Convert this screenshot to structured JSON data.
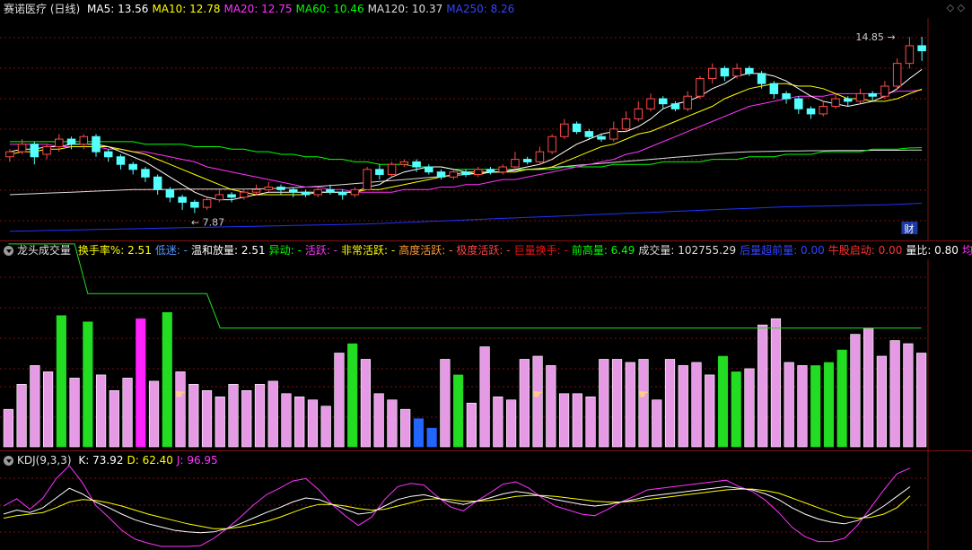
{
  "colors": {
    "bg": "#000000",
    "up": "#ff4a4a",
    "down": "#54ffff",
    "grid": "#7a1010",
    "ma5": "#ffffff",
    "ma10": "#ffff00",
    "ma20": "#ff33ff",
    "ma60": "#00ff00",
    "ma120": "#dddddd",
    "ma250": "#2233ff"
  },
  "price_panel": {
    "title": "赛诺医疗 (日线)",
    "indicators": [
      {
        "label": "MA5: 13.56",
        "color": "#ffffff"
      },
      {
        "label": "MA10: 12.78",
        "color": "#ffff00"
      },
      {
        "label": "MA20: 12.75",
        "color": "#ff33ff"
      },
      {
        "label": "MA60: 10.46",
        "color": "#00ff00"
      },
      {
        "label": "MA120: 10.37",
        "color": "#dddddd"
      },
      {
        "label": "MA250: 8.26",
        "color": "#3344ff"
      }
    ],
    "high_label": "14.85",
    "low_label": "7.87",
    "cai_badge": "财",
    "corner_icons": "◇  ◇"
  },
  "volume_panel": {
    "title": "龙头成交量",
    "indicators": [
      {
        "label": "换手率%: 2.51",
        "color": "#ffff00"
      },
      {
        "label": "低迷: -",
        "color": "#5599ff"
      },
      {
        "label": "温和放量: 2.51",
        "color": "#ffffff"
      },
      {
        "label": "异动: -",
        "color": "#00ff00"
      },
      {
        "label": "活跃: -",
        "color": "#ff33ff"
      },
      {
        "label": "非常活跃: -",
        "color": "#ffff00"
      },
      {
        "label": "高度活跃: -",
        "color": "#ff9933"
      },
      {
        "label": "极度活跃: -",
        "color": "#ff4444"
      },
      {
        "label": "巨量换手: -",
        "color": "#ee1111"
      },
      {
        "label": "前高量: 6.49",
        "color": "#00ff00"
      },
      {
        "label": "成交量: 102755.29",
        "color": "#dddddd"
      },
      {
        "label": "后量超前量: 0.00",
        "color": "#3344ff"
      },
      {
        "label": "牛股启动: 0.00",
        "color": "#ff3333"
      },
      {
        "label": "量比: 0.80",
        "color": "#ffffff"
      },
      {
        "label": "均量金叉",
        "color": "#ff33ff"
      }
    ]
  },
  "kdj_panel": {
    "title": "KDJ(9,3,3)",
    "indicators": [
      {
        "label": "K: 73.92",
        "color": "#ffffff"
      },
      {
        "label": "D: 62.40",
        "color": "#ffff00"
      },
      {
        "label": "J: 96.95",
        "color": "#ff33ff"
      }
    ]
  },
  "chart_data": {
    "type": "candlestick",
    "price_range": [
      7.0,
      15.6
    ],
    "candles": [
      [
        10.1,
        10.3,
        9.9,
        10.4
      ],
      [
        10.3,
        10.6,
        10.2,
        10.8
      ],
      [
        10.6,
        10.1,
        9.8,
        10.7
      ],
      [
        10.2,
        10.5,
        10.0,
        10.6
      ],
      [
        10.5,
        10.8,
        10.3,
        11.0
      ],
      [
        10.8,
        10.6,
        10.4,
        10.9
      ],
      [
        10.6,
        10.9,
        10.4,
        11.0
      ],
      [
        10.9,
        10.3,
        10.1,
        11.0
      ],
      [
        10.3,
        10.1,
        9.9,
        10.4
      ],
      [
        10.1,
        9.8,
        9.6,
        10.2
      ],
      [
        9.8,
        9.6,
        9.4,
        9.9
      ],
      [
        9.6,
        9.3,
        9.1,
        9.7
      ],
      [
        9.3,
        8.8,
        8.6,
        9.4
      ],
      [
        8.8,
        8.5,
        8.3,
        8.9
      ],
      [
        8.5,
        8.3,
        8.0,
        8.6
      ],
      [
        8.3,
        8.1,
        7.87,
        8.4
      ],
      [
        8.1,
        8.4,
        8.0,
        8.5
      ],
      [
        8.4,
        8.6,
        8.3,
        8.8
      ],
      [
        8.6,
        8.5,
        8.3,
        8.7
      ],
      [
        8.5,
        8.7,
        8.4,
        8.8
      ],
      [
        8.7,
        8.8,
        8.6,
        9.0
      ],
      [
        8.8,
        8.9,
        8.7,
        9.1
      ],
      [
        8.9,
        8.8,
        8.6,
        9.0
      ],
      [
        8.8,
        8.7,
        8.5,
        8.9
      ],
      [
        8.7,
        8.6,
        8.5,
        8.8
      ],
      [
        8.6,
        8.8,
        8.5,
        8.9
      ],
      [
        8.8,
        8.7,
        8.6,
        9.0
      ],
      [
        8.7,
        8.6,
        8.4,
        8.8
      ],
      [
        8.6,
        8.8,
        8.5,
        8.9
      ],
      [
        8.8,
        9.6,
        8.8,
        9.7
      ],
      [
        9.6,
        9.4,
        9.2,
        9.8
      ],
      [
        9.4,
        9.8,
        9.3,
        9.9
      ],
      [
        9.8,
        9.9,
        9.7,
        10.0
      ],
      [
        9.9,
        9.7,
        9.5,
        10.0
      ],
      [
        9.7,
        9.5,
        9.4,
        9.8
      ],
      [
        9.5,
        9.3,
        9.2,
        9.6
      ],
      [
        9.3,
        9.5,
        9.2,
        9.6
      ],
      [
        9.5,
        9.4,
        9.3,
        9.6
      ],
      [
        9.4,
        9.6,
        9.3,
        9.7
      ],
      [
        9.6,
        9.5,
        9.4,
        9.7
      ],
      [
        9.5,
        9.7,
        9.4,
        9.8
      ],
      [
        9.7,
        10.0,
        9.6,
        10.3
      ],
      [
        10.0,
        9.9,
        9.8,
        10.1
      ],
      [
        9.9,
        10.3,
        9.8,
        10.5
      ],
      [
        10.3,
        10.9,
        10.2,
        11.0
      ],
      [
        10.9,
        11.4,
        10.8,
        11.6
      ],
      [
        11.4,
        11.1,
        11.0,
        11.5
      ],
      [
        11.1,
        10.9,
        10.8,
        11.2
      ],
      [
        10.9,
        10.8,
        10.7,
        11.0
      ],
      [
        10.8,
        11.2,
        10.7,
        11.5
      ],
      [
        11.2,
        11.6,
        11.1,
        11.9
      ],
      [
        11.6,
        12.0,
        11.5,
        12.3
      ],
      [
        12.0,
        12.4,
        11.9,
        12.6
      ],
      [
        12.4,
        12.2,
        12.0,
        12.5
      ],
      [
        12.2,
        12.0,
        11.9,
        12.3
      ],
      [
        12.0,
        12.5,
        11.9,
        12.7
      ],
      [
        12.5,
        13.2,
        12.4,
        13.3
      ],
      [
        13.2,
        13.6,
        13.0,
        13.8
      ],
      [
        13.6,
        13.3,
        13.1,
        13.7
      ],
      [
        13.3,
        13.6,
        13.2,
        13.8
      ],
      [
        13.6,
        13.4,
        13.3,
        13.7
      ],
      [
        13.4,
        13.0,
        12.8,
        13.5
      ],
      [
        13.0,
        12.6,
        12.4,
        13.1
      ],
      [
        12.6,
        12.4,
        12.2,
        12.7
      ],
      [
        12.4,
        12.0,
        11.8,
        12.5
      ],
      [
        12.0,
        11.8,
        11.6,
        12.1
      ],
      [
        11.8,
        12.1,
        11.7,
        12.3
      ],
      [
        12.1,
        12.4,
        12.0,
        12.6
      ],
      [
        12.4,
        12.3,
        12.1,
        12.5
      ],
      [
        12.3,
        12.6,
        12.2,
        12.8
      ],
      [
        12.6,
        12.5,
        12.3,
        12.7
      ],
      [
        12.5,
        12.9,
        12.4,
        13.1
      ],
      [
        12.9,
        13.8,
        12.8,
        14.0
      ],
      [
        13.8,
        14.5,
        13.6,
        14.85
      ],
      [
        14.5,
        14.3,
        13.9,
        14.85
      ]
    ],
    "ma5": [
      10.3,
      10.4,
      10.4,
      10.5,
      10.5,
      10.6,
      10.6,
      10.6,
      10.5,
      10.3,
      10.1,
      9.9,
      9.6,
      9.3,
      9.0,
      8.7,
      8.5,
      8.4,
      8.4,
      8.5,
      8.6,
      8.7,
      8.7,
      8.7,
      8.7,
      8.7,
      8.7,
      8.7,
      8.7,
      8.9,
      9.0,
      9.3,
      9.5,
      9.6,
      9.7,
      9.7,
      9.6,
      9.5,
      9.4,
      9.5,
      9.5,
      9.6,
      9.7,
      9.8,
      10.0,
      10.3,
      10.6,
      10.8,
      11.0,
      11.1,
      11.1,
      11.3,
      11.6,
      12.0,
      12.2,
      12.3,
      12.5,
      12.8,
      13.0,
      13.3,
      13.4,
      13.4,
      13.3,
      13.1,
      12.8,
      12.5,
      12.3,
      12.2,
      12.1,
      12.2,
      12.3,
      12.5,
      12.8,
      13.2,
      13.56
    ],
    "ma10": [
      10.2,
      10.3,
      10.3,
      10.4,
      10.4,
      10.5,
      10.5,
      10.5,
      10.5,
      10.4,
      10.3,
      10.2,
      10.0,
      9.8,
      9.6,
      9.4,
      9.2,
      9.0,
      8.8,
      8.7,
      8.6,
      8.6,
      8.6,
      8.6,
      8.6,
      8.7,
      8.7,
      8.7,
      8.7,
      8.8,
      8.8,
      8.9,
      9.0,
      9.1,
      9.2,
      9.3,
      9.4,
      9.5,
      9.5,
      9.5,
      9.5,
      9.5,
      9.6,
      9.6,
      9.7,
      9.9,
      10.1,
      10.3,
      10.5,
      10.6,
      10.8,
      11.0,
      11.1,
      11.3,
      11.5,
      11.7,
      11.9,
      12.1,
      12.4,
      12.6,
      12.8,
      12.9,
      13.0,
      13.0,
      12.9,
      12.9,
      12.8,
      12.6,
      12.4,
      12.4,
      12.3,
      12.3,
      12.4,
      12.6,
      12.78
    ],
    "ma20": [
      10.6,
      10.6,
      10.6,
      10.6,
      10.5,
      10.5,
      10.5,
      10.5,
      10.4,
      10.4,
      10.3,
      10.3,
      10.2,
      10.1,
      10.0,
      9.9,
      9.7,
      9.6,
      9.5,
      9.4,
      9.3,
      9.2,
      9.1,
      9.0,
      8.9,
      8.9,
      8.8,
      8.8,
      8.7,
      8.7,
      8.7,
      8.7,
      8.8,
      8.8,
      8.8,
      8.9,
      8.9,
      9.0,
      9.0,
      9.1,
      9.2,
      9.2,
      9.3,
      9.4,
      9.5,
      9.6,
      9.7,
      9.8,
      9.9,
      10.0,
      10.2,
      10.3,
      10.5,
      10.7,
      10.9,
      11.1,
      11.3,
      11.5,
      11.7,
      11.9,
      12.1,
      12.2,
      12.3,
      12.4,
      12.5,
      12.5,
      12.5,
      12.6,
      12.6,
      12.6,
      12.6,
      12.6,
      12.7,
      12.7,
      12.75
    ],
    "ma60": [
      10.7,
      10.7,
      10.7,
      10.7,
      10.7,
      10.7,
      10.7,
      10.7,
      10.7,
      10.7,
      10.7,
      10.6,
      10.6,
      10.6,
      10.6,
      10.5,
      10.5,
      10.5,
      10.4,
      10.4,
      10.3,
      10.3,
      10.2,
      10.2,
      10.1,
      10.1,
      10.0,
      10.0,
      9.9,
      9.9,
      9.8,
      9.8,
      9.8,
      9.7,
      9.7,
      9.7,
      9.6,
      9.6,
      9.6,
      9.6,
      9.6,
      9.6,
      9.6,
      9.6,
      9.6,
      9.7,
      9.7,
      9.7,
      9.7,
      9.8,
      9.8,
      9.8,
      9.8,
      9.9,
      9.9,
      9.9,
      9.9,
      10.0,
      10.0,
      10.0,
      10.1,
      10.1,
      10.1,
      10.2,
      10.2,
      10.2,
      10.3,
      10.3,
      10.3,
      10.3,
      10.4,
      10.4,
      10.4,
      10.45,
      10.46
    ],
    "ma120": [
      8.6,
      8.62,
      8.64,
      8.66,
      8.68,
      8.7,
      8.72,
      8.74,
      8.76,
      8.78,
      8.8,
      8.8,
      8.81,
      8.81,
      8.82,
      8.82,
      8.82,
      8.82,
      8.82,
      8.82,
      8.83,
      8.84,
      8.86,
      8.88,
      8.9,
      8.93,
      8.96,
      9.0,
      9.04,
      9.08,
      9.12,
      9.16,
      9.2,
      9.24,
      9.28,
      9.32,
      9.36,
      9.4,
      9.44,
      9.48,
      9.52,
      9.56,
      9.6,
      9.64,
      9.68,
      9.72,
      9.76,
      9.8,
      9.84,
      9.88,
      9.92,
      9.96,
      10.0,
      10.04,
      10.08,
      10.12,
      10.16,
      10.2,
      10.24,
      10.28,
      10.3,
      10.31,
      10.32,
      10.33,
      10.33,
      10.34,
      10.34,
      10.35,
      10.35,
      10.35,
      10.36,
      10.36,
      10.36,
      10.37,
      10.37
    ],
    "ma250": [
      7.15,
      7.16,
      7.17,
      7.18,
      7.19,
      7.2,
      7.21,
      7.22,
      7.23,
      7.24,
      7.25,
      7.26,
      7.27,
      7.28,
      7.29,
      7.3,
      7.31,
      7.32,
      7.33,
      7.34,
      7.35,
      7.36,
      7.37,
      7.38,
      7.39,
      7.4,
      7.41,
      7.42,
      7.43,
      7.44,
      7.46,
      7.48,
      7.5,
      7.52,
      7.54,
      7.56,
      7.58,
      7.6,
      7.62,
      7.64,
      7.66,
      7.68,
      7.7,
      7.72,
      7.74,
      7.76,
      7.78,
      7.8,
      7.82,
      7.84,
      7.86,
      7.88,
      7.9,
      7.92,
      7.94,
      7.96,
      7.98,
      8.0,
      8.02,
      8.04,
      8.06,
      8.08,
      8.1,
      8.12,
      8.13,
      8.14,
      8.15,
      8.16,
      8.17,
      8.18,
      8.19,
      8.2,
      8.22,
      8.24,
      8.26
    ],
    "volume_range": [
      0,
      6.0
    ],
    "volume": [
      1.2,
      2.0,
      2.6,
      2.4,
      4.2,
      2.2,
      4.0,
      2.3,
      1.8,
      2.2,
      4.1,
      2.1,
      4.3,
      2.4,
      2.0,
      1.8,
      1.6,
      2.0,
      1.8,
      2.0,
      2.1,
      1.7,
      1.6,
      1.5,
      1.3,
      3.0,
      3.3,
      2.8,
      1.7,
      1.5,
      1.2,
      0.9,
      0.6,
      2.8,
      2.3,
      1.4,
      3.2,
      1.6,
      1.5,
      2.8,
      2.9,
      2.6,
      1.7,
      1.7,
      1.6,
      2.8,
      2.8,
      2.7,
      2.8,
      1.5,
      2.8,
      2.6,
      2.7,
      2.3,
      2.9,
      2.4,
      2.5,
      3.9,
      4.1,
      2.7,
      2.6,
      2.6,
      2.7,
      3.1,
      3.6,
      3.8,
      2.9,
      3.4,
      3.3,
      3.0
    ],
    "volume_colors": [
      "p",
      "p",
      "p",
      "p",
      "g",
      "p",
      "g",
      "p",
      "p",
      "p",
      "m",
      "p",
      "g",
      "p",
      "p",
      "p",
      "p",
      "p",
      "p",
      "p",
      "p",
      "p",
      "p",
      "p",
      "p",
      "p",
      "g",
      "p",
      "p",
      "p",
      "p",
      "b",
      "b",
      "p",
      "g",
      "p",
      "p",
      "p",
      "p",
      "p",
      "p",
      "p",
      "p",
      "p",
      "p",
      "p",
      "p",
      "p",
      "p",
      "p",
      "p",
      "p",
      "p",
      "p",
      "g",
      "g",
      "p",
      "p",
      "p",
      "p",
      "p",
      "g",
      "g",
      "g",
      "p",
      "p",
      "p",
      "p",
      "p",
      "p"
    ],
    "turnover_line": [
      6.49,
      6.49,
      6.49,
      6.49,
      6.49,
      6.49,
      4.9,
      4.9,
      4.9,
      4.9,
      4.9,
      4.9,
      4.9,
      4.9,
      4.9,
      4.9,
      3.8,
      3.8,
      3.8,
      3.8,
      3.8,
      3.8,
      3.8,
      3.8,
      3.8,
      3.8,
      3.8,
      3.8,
      3.8,
      3.8,
      3.8,
      3.8,
      3.8,
      3.8,
      3.8,
      3.8,
      3.8,
      3.8,
      3.8,
      3.8,
      3.8,
      3.8,
      3.8,
      3.8,
      3.8,
      3.8,
      3.8,
      3.8,
      3.8,
      3.8,
      3.8,
      3.8,
      3.8,
      3.8,
      3.8,
      3.8,
      3.8,
      3.8,
      3.8,
      3.8,
      3.8,
      3.8,
      3.8,
      3.8,
      3.8,
      3.8,
      3.8,
      3.8,
      3.8,
      3.8
    ],
    "kdj_range": [
      0,
      100
    ],
    "k": [
      40,
      45,
      42,
      48,
      60,
      72,
      65,
      55,
      48,
      40,
      33,
      28,
      24,
      20,
      18,
      17,
      18,
      22,
      28,
      35,
      42,
      48,
      55,
      60,
      58,
      52,
      46,
      40,
      42,
      50,
      58,
      62,
      64,
      60,
      55,
      52,
      56,
      60,
      65,
      68,
      66,
      62,
      58,
      55,
      52,
      50,
      52,
      55,
      58,
      62,
      64,
      66,
      68,
      70,
      72,
      74,
      72,
      70,
      65,
      58,
      48,
      40,
      34,
      30,
      28,
      32,
      40,
      50,
      62,
      73.92
    ],
    "d": [
      35,
      38,
      40,
      42,
      48,
      55,
      58,
      57,
      54,
      50,
      45,
      40,
      36,
      32,
      28,
      25,
      22,
      22,
      24,
      27,
      31,
      36,
      42,
      48,
      52,
      52,
      50,
      47,
      45,
      46,
      50,
      54,
      58,
      59,
      58,
      56,
      56,
      57,
      59,
      62,
      63,
      63,
      62,
      60,
      58,
      56,
      55,
      55,
      56,
      58,
      60,
      62,
      64,
      66,
      68,
      70,
      71,
      71,
      69,
      66,
      60,
      54,
      48,
      42,
      37,
      35,
      36,
      40,
      48,
      62.4
    ],
    "j": [
      50,
      59,
      46,
      60,
      84,
      106,
      79,
      51,
      36,
      20,
      9,
      4,
      0,
      0,
      0,
      1,
      10,
      22,
      36,
      51,
      64,
      72,
      81,
      84,
      70,
      52,
      38,
      26,
      36,
      58,
      74,
      78,
      76,
      62,
      49,
      44,
      56,
      66,
      77,
      80,
      72,
      60,
      50,
      45,
      40,
      38,
      46,
      55,
      62,
      70,
      72,
      74,
      76,
      78,
      80,
      82,
      74,
      68,
      57,
      42,
      24,
      12,
      6,
      6,
      10,
      26,
      48,
      70,
      90,
      96.95
    ]
  }
}
